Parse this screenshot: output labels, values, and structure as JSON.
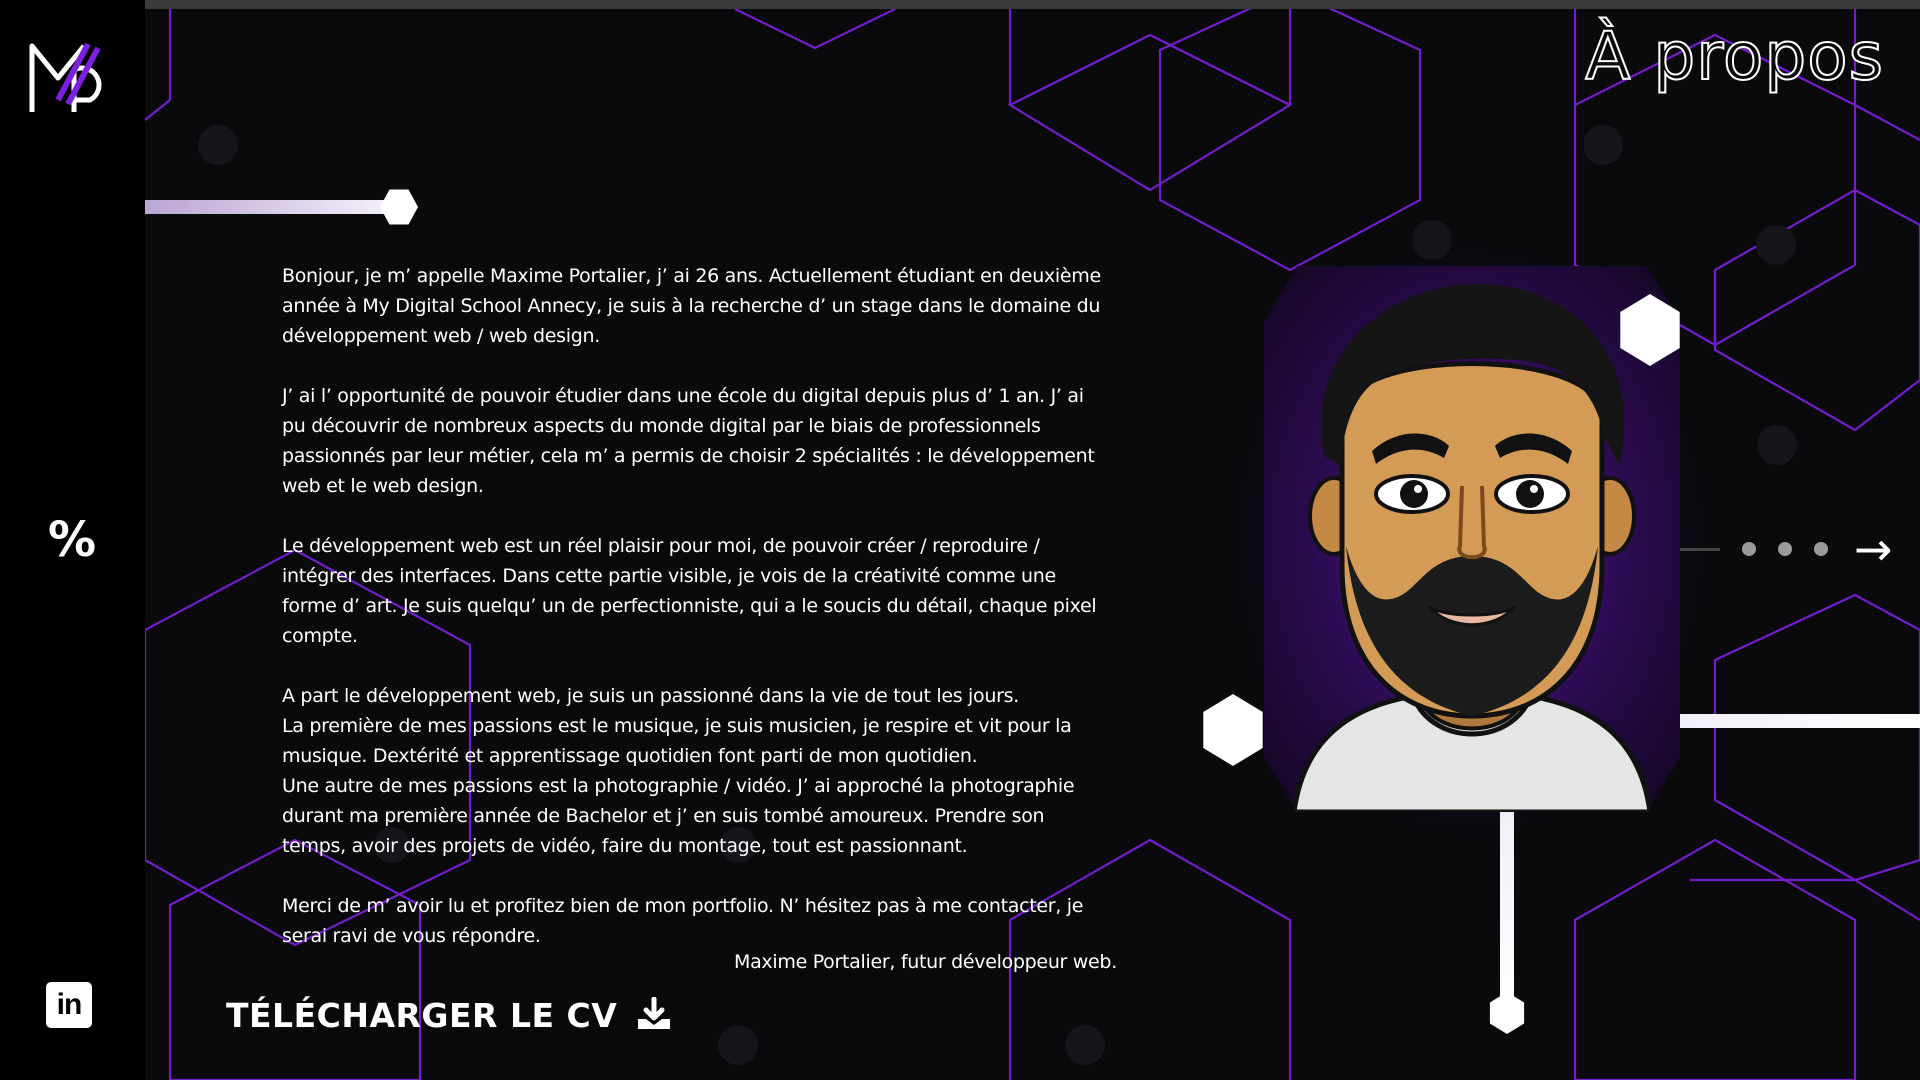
{
  "page": {
    "title": "À propos"
  },
  "sidebar": {
    "logo_icon": "mp-logo-icon",
    "percent_icon": "%",
    "linkedin_icon": "in"
  },
  "about": {
    "paragraphs": [
      "Bonjour, je m’ appelle Maxime Portalier, j’ ai 26 ans. Actuellement étudiant en deuxième année à My Digital School Annecy, je suis à la recherche d’ un stage dans le domaine du développement web / web design.",
      "J’ ai l’ opportunité de pouvoir étudier dans une école du digital depuis plus d’ 1 an. J’ ai pu découvrir de nombreux aspects du monde digital par le biais de professionnels passionnés par leur métier, cela m’ a permis de choisir 2 spécialités : le développement web et le web design.",
      "Le développement web est un réel plaisir pour moi, de pouvoir créer / reproduire / intégrer des interfaces. Dans cette partie visible, je vois de la créativité comme une forme d’ art. Je suis quelqu’ un de perfectionniste, qui a le soucis du détail, chaque pixel compte.",
      "A part le développement web, je suis un passionné dans la vie de tout les jours.",
      "La première de mes passions est le musique, je suis musicien, je respire et vit pour la musique. Dextérité et apprentissage quotidien font parti de mon quotidien.",
      "Une autre de mes passions est la photographie / vidéo. J’ ai approché la photographie durant ma première année de Bachelor et j’ en suis tombé amoureux. Prendre son temps, avoir des projets de vidéo, faire du montage, tout est passionnant.",
      "Merci de m’ avoir lu et profitez bien de mon portfolio. N’ hésitez pas à me contacter, je serai ravi de vous répondre."
    ],
    "signature": "Maxime Portalier, futur développeur web."
  },
  "cv": {
    "label": "TÉLÉCHARGER LE CV",
    "icon": "download-icon"
  },
  "slider": {
    "dots": 3,
    "arrow": "→"
  },
  "colors": {
    "background": "#0a090c",
    "accent_purple": "#7b1fe0",
    "sidebar": "#000000"
  }
}
